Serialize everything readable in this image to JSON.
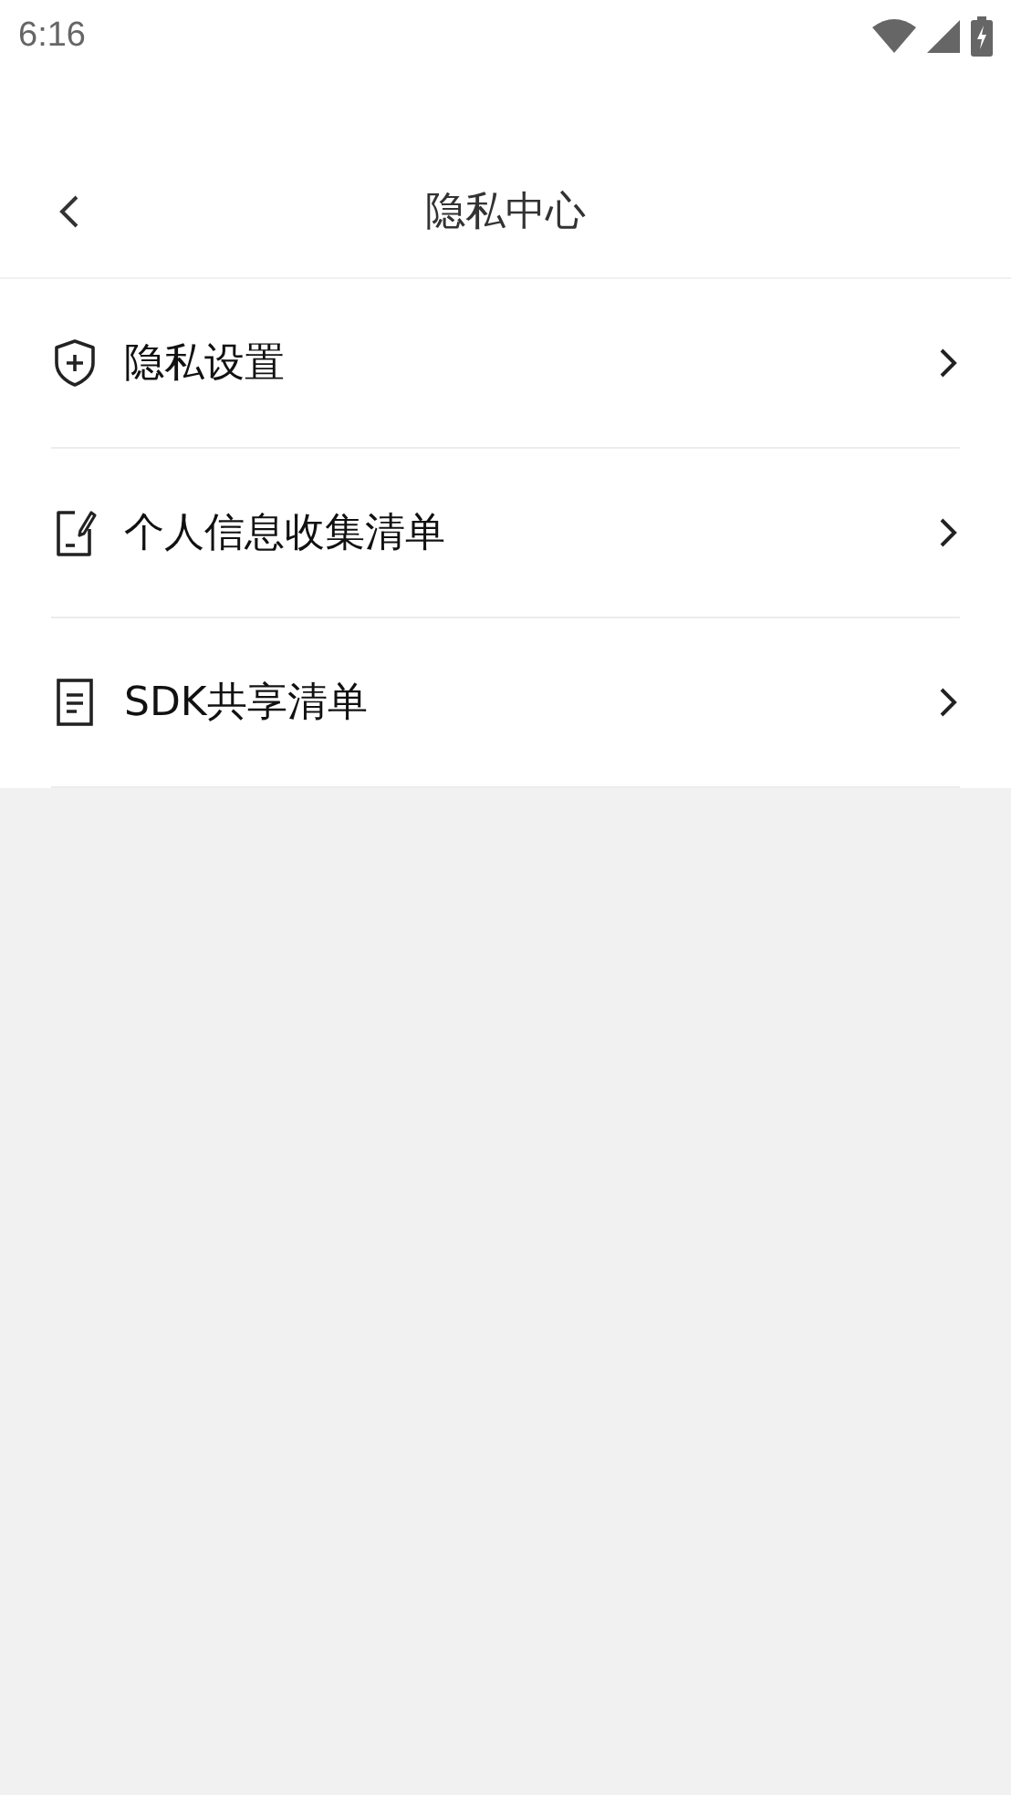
{
  "status_bar": {
    "time": "6:16"
  },
  "header": {
    "title": "隐私中心"
  },
  "menu": [
    {
      "label": "隐私设置"
    },
    {
      "label": "个人信息收集清单"
    },
    {
      "label": "SDK共享清单"
    }
  ]
}
